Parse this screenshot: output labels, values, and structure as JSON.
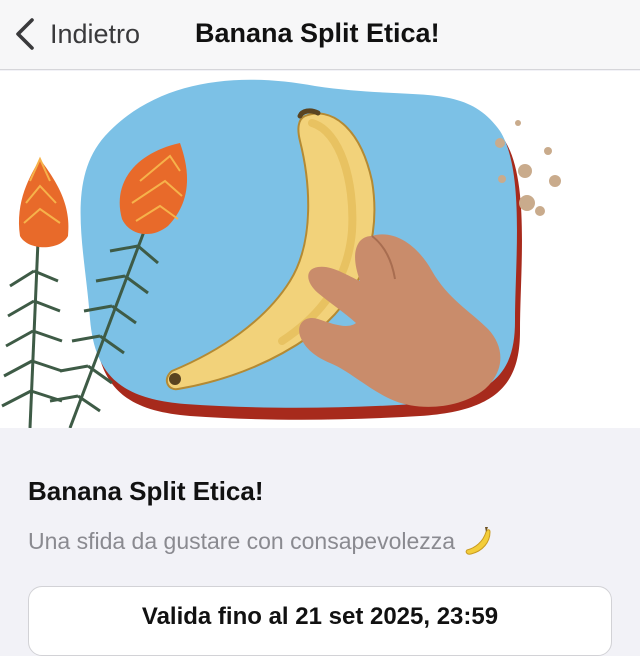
{
  "nav": {
    "back_label": "Indietro",
    "title": "Banana Split Etica!"
  },
  "hero": {
    "image": "hand-holding-banana-illustration",
    "background_color": "#7cc1e6",
    "accent_color": "#a72a1c"
  },
  "card": {
    "title": "Banana Split Etica!",
    "subtitle": "Una sfida da gustare con consapevolezza",
    "subtitle_icon": "banana-icon",
    "validity": "Valida fino al 21 set 2025, 23:59"
  }
}
